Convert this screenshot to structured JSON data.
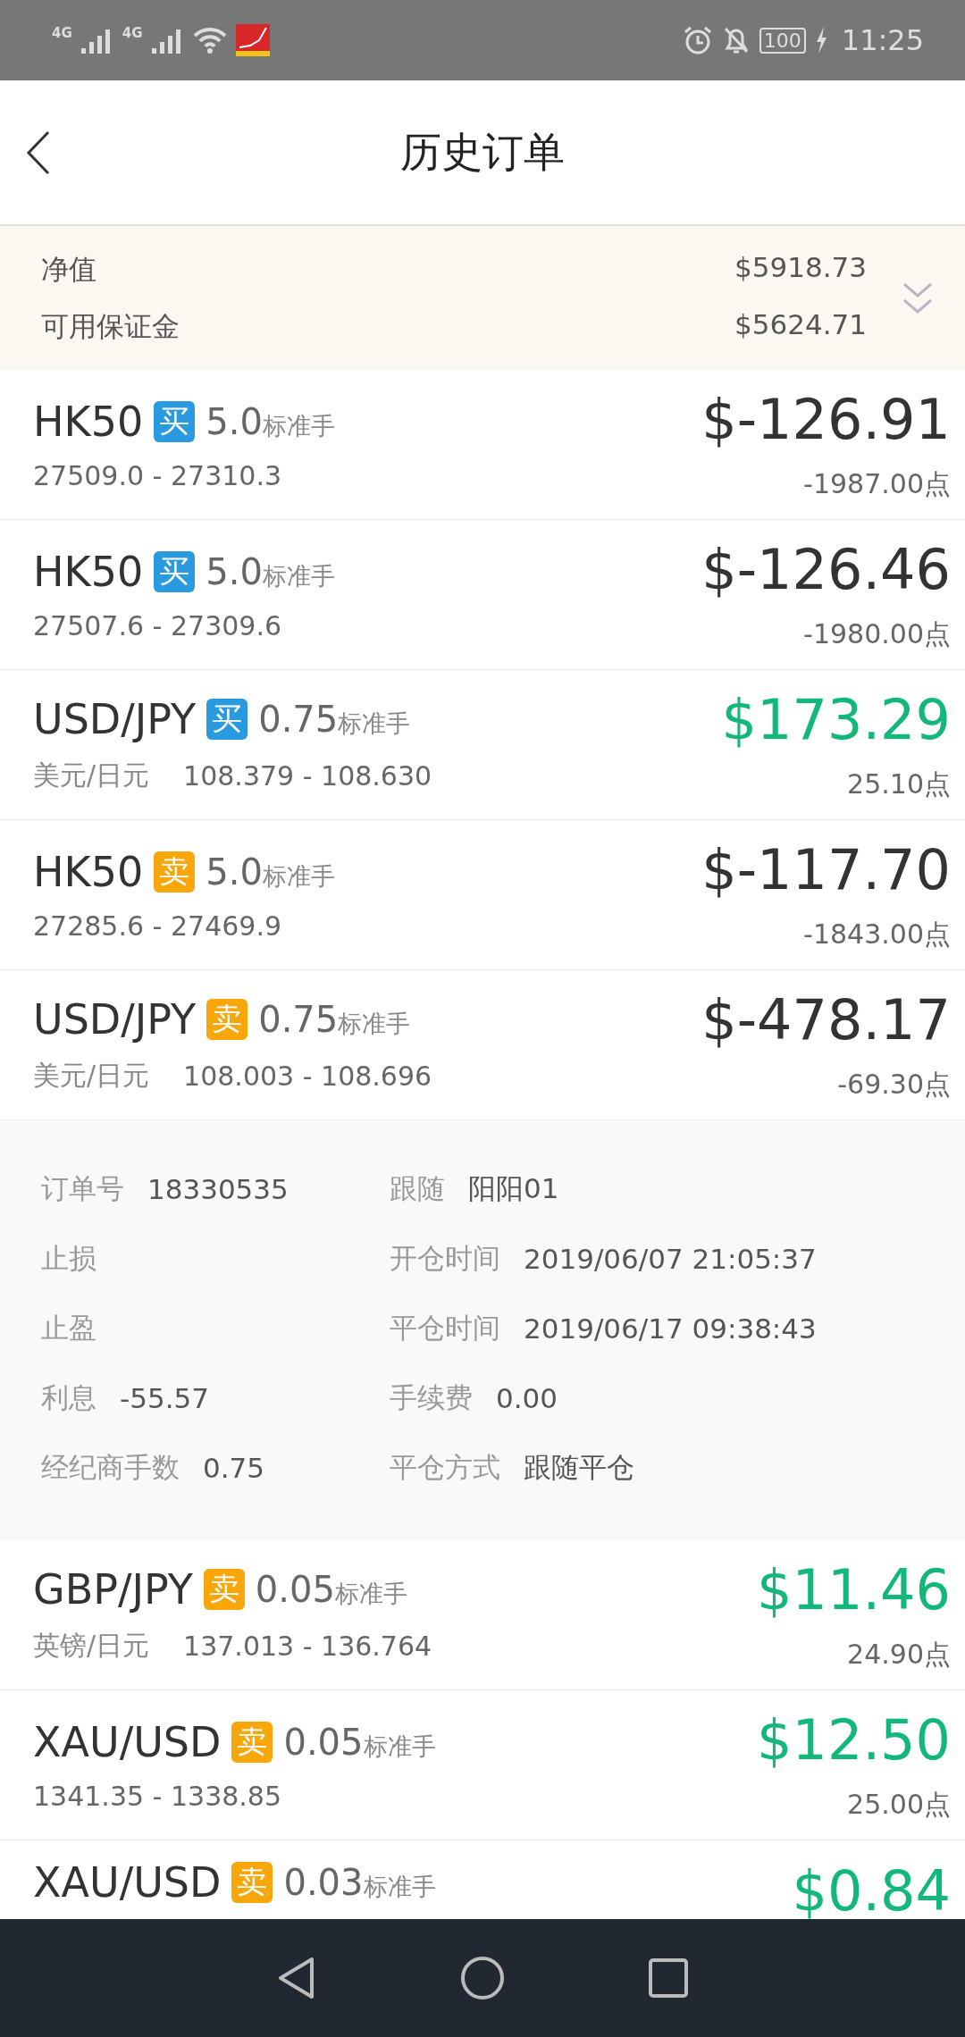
{
  "status_bar": {
    "network_1": "4G",
    "network_2": "4G",
    "battery": "100",
    "time": "11:25"
  },
  "header": {
    "title": "历史订单"
  },
  "summary": {
    "expanded": false,
    "items": [
      {
        "label": "净值",
        "value": "$5918.73"
      },
      {
        "label": "可用保证金",
        "value": "$5624.71"
      }
    ]
  },
  "orders": [
    {
      "symbol": "HK50",
      "side": "买",
      "kind": "buy",
      "lots": "5.0",
      "unit": "标准手",
      "prices": "27509.0 - 27310.3",
      "pnl": "$-126.91",
      "color": "#333333",
      "points": "-1987.00点",
      "expanded": false
    },
    {
      "symbol": "HK50",
      "side": "买",
      "kind": "buy",
      "lots": "5.0",
      "unit": "标准手",
      "prices": "27507.6 - 27309.6",
      "pnl": "$-126.46",
      "color": "#333333",
      "points": "-1980.00点",
      "expanded": false
    },
    {
      "symbol": "USD/JPY",
      "side": "买",
      "kind": "buy",
      "lots": "0.75",
      "unit": "标准手",
      "name": "美元/日元",
      "prices": "108.379 - 108.630",
      "pnl": "$173.29",
      "color": "#12b77a",
      "points": "25.10点",
      "expanded": false
    },
    {
      "symbol": "HK50",
      "side": "卖",
      "kind": "sell",
      "lots": "5.0",
      "unit": "标准手",
      "prices": "27285.6 - 27469.9",
      "pnl": "$-117.70",
      "color": "#333333",
      "points": "-1843.00点",
      "expanded": false
    },
    {
      "symbol": "USD/JPY",
      "side": "卖",
      "kind": "sell",
      "lots": "0.75",
      "unit": "标准手",
      "name": "美元/日元",
      "prices": "108.003 - 108.696",
      "pnl": "$-478.17",
      "color": "#333333",
      "points": "-69.30点",
      "expanded": true,
      "details": [
        {
          "label": "订单号",
          "value": "18330535"
        },
        {
          "label": "跟随",
          "value": "阳阳01"
        },
        {
          "label": "止损"
        },
        {
          "label": "开仓时间",
          "value": "2019/06/07 21:05:37"
        },
        {
          "label": "止盈"
        },
        {
          "label": "平仓时间",
          "value": "2019/06/17 09:38:43"
        },
        {
          "label": "利息",
          "value": "-55.57"
        },
        {
          "label": "手续费",
          "value": "0.00"
        },
        {
          "label": "经纪商手数",
          "value": "0.75"
        },
        {
          "label": "平仓方式",
          "value": "跟随平仓"
        }
      ]
    },
    {
      "symbol": "GBP/JPY",
      "side": "卖",
      "kind": "sell",
      "lots": "0.05",
      "unit": "标准手",
      "name": "英镑/日元",
      "prices": "137.013 - 136.764",
      "pnl": "$11.46",
      "color": "#12b77a",
      "points": "24.90点",
      "expanded": false
    },
    {
      "symbol": "XAU/USD",
      "side": "卖",
      "kind": "sell",
      "lots": "0.05",
      "unit": "标准手",
      "prices": "1341.35 - 1338.85",
      "pnl": "$12.50",
      "color": "#12b77a",
      "points": "25.00点",
      "expanded": false
    },
    {
      "symbol": "XAU/USD",
      "side": "卖",
      "kind": "sell",
      "lots": "0.03",
      "unit": "标准手",
      "pnl": "$0.84",
      "color": "#12b77a",
      "expanded": false
    }
  ]
}
